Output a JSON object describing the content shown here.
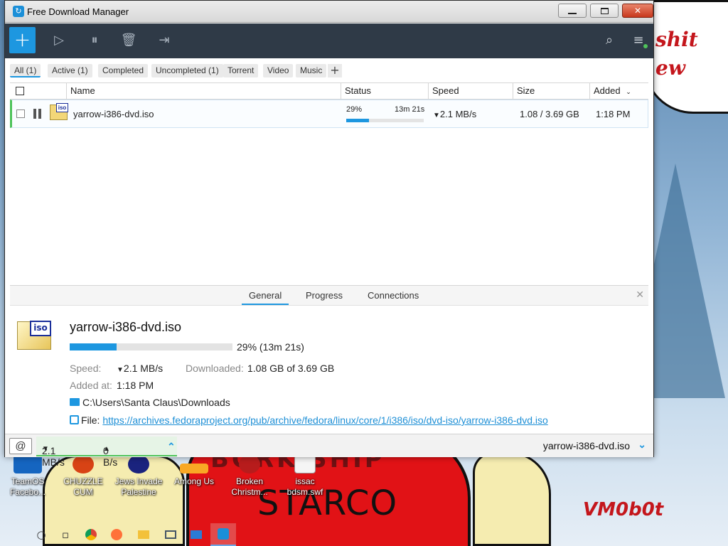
{
  "window": {
    "title": "Free Download Manager"
  },
  "toolbar": {
    "add_label": "+"
  },
  "filters": [
    {
      "label": "All (1)",
      "selected": true
    },
    {
      "label": "Active (1)",
      "selected": false
    },
    {
      "label": "Completed",
      "selected": false
    },
    {
      "label": "Uncompleted (1)",
      "selected": false
    },
    {
      "label": "Torrent",
      "selected": false
    },
    {
      "label": "Video",
      "selected": false
    },
    {
      "label": "Music",
      "selected": false
    }
  ],
  "filter_add_label": "+",
  "table": {
    "headers": [
      "Name",
      "Status",
      "Speed",
      "Size",
      "Added"
    ],
    "rows": [
      {
        "name": "yarrow-i386-dvd.iso",
        "status_percent": "29%",
        "status_time": "13m 21s",
        "progress": 0.29,
        "speed": "2.1 MB/s",
        "size": "1.08 / 3.69 GB",
        "added": "1:18 PM"
      }
    ]
  },
  "details": {
    "tabs": [
      "General",
      "Progress",
      "Connections"
    ],
    "file_name": "yarrow-i386-dvd.iso",
    "progress": 0.29,
    "progress_text": "29% (13m 21s)",
    "speed_label": "Speed:",
    "speed_value": "2.1 MB/s",
    "downloaded_label": "Downloaded:",
    "downloaded_value": "1.08 GB of 3.69 GB",
    "added_label": "Added at:",
    "added_value": "1:18 PM",
    "folder": "C:\\Users\\Santa Claus\\Downloads",
    "file_label": "File:",
    "file_url": "https://archives.fedoraproject.org/pub/archive/fedora/linux/core/1/i386/iso/dvd-iso/yarrow-i386-dvd.iso"
  },
  "statusbar": {
    "down_speed": "2.1 MB/s",
    "up_speed": "0 B/s",
    "current_file": "yarrow-i386-dvd.iso"
  },
  "desktop": {
    "icons": [
      {
        "label": "TeamOS Facebo..."
      },
      {
        "label": "CHUZZLE CUM"
      },
      {
        "label": "Jews Invade Palestine"
      },
      {
        "label": "Among Us"
      },
      {
        "label": "Broken Christm..."
      },
      {
        "label": "issac bdsm.swf"
      }
    ],
    "bubble_text_1": "shit",
    "bubble_text_2": "ew",
    "banner_top": "BORK SHIP",
    "banner_text": "STARCO",
    "signature": "VM0b0t"
  },
  "colors": {
    "accent": "#1d97e0",
    "toolbar_bg": "#2f3a47",
    "active_green": "#4fc35a"
  }
}
